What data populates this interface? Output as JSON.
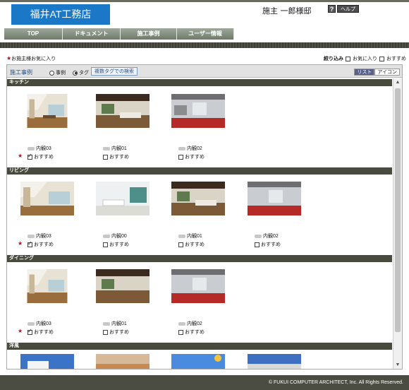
{
  "header": {
    "brand": "福井AT工務店",
    "owner": "施主 一郎様邸",
    "help_icon": "?",
    "help_label": "ヘルプ"
  },
  "nav": {
    "items": [
      "TOP",
      "ドキュメント",
      "施工事例",
      "ユーザー情報"
    ]
  },
  "favorites_link": "お施主様お気に入り",
  "filter": {
    "label": "絞り込み",
    "favorites": "お気に入り",
    "recommended": "おすすめ"
  },
  "panel": {
    "title": "施工事例",
    "radio_case": "事例",
    "radio_tag": "タグ",
    "multi_tag_search": "複数タグでの検索",
    "tab_list": "リスト",
    "tab_icon": "アイコン"
  },
  "recommend_label": "おすすめ",
  "sections": [
    {
      "title": "キッチン",
      "items": [
        {
          "caption": "内観03",
          "checked": true,
          "star": true
        },
        {
          "caption": "内観01",
          "checked": false,
          "star": false
        },
        {
          "caption": "内観02",
          "checked": false,
          "star": false
        }
      ]
    },
    {
      "title": "リビング",
      "items": [
        {
          "caption": "内観03",
          "checked": true,
          "star": true
        },
        {
          "caption": "内観00",
          "checked": false,
          "star": false
        },
        {
          "caption": "内観01",
          "checked": false,
          "star": false
        },
        {
          "caption": "内観02",
          "checked": false,
          "star": false
        }
      ]
    },
    {
      "title": "ダイニング",
      "items": [
        {
          "caption": "内観03",
          "checked": true,
          "star": true
        },
        {
          "caption": "内観01",
          "checked": false,
          "star": false
        },
        {
          "caption": "内観02",
          "checked": false,
          "star": false
        }
      ]
    },
    {
      "title": "洋風",
      "items": []
    }
  ],
  "footer": "© FUKUI COMPUTER ARCHITECT, Inc. All Rights Reserved.",
  "colors": {
    "brand_blue": "#1b78c6",
    "favorite_star": "#b4141b",
    "section_bar": "#474a3d",
    "footer": "#4b4d43"
  }
}
